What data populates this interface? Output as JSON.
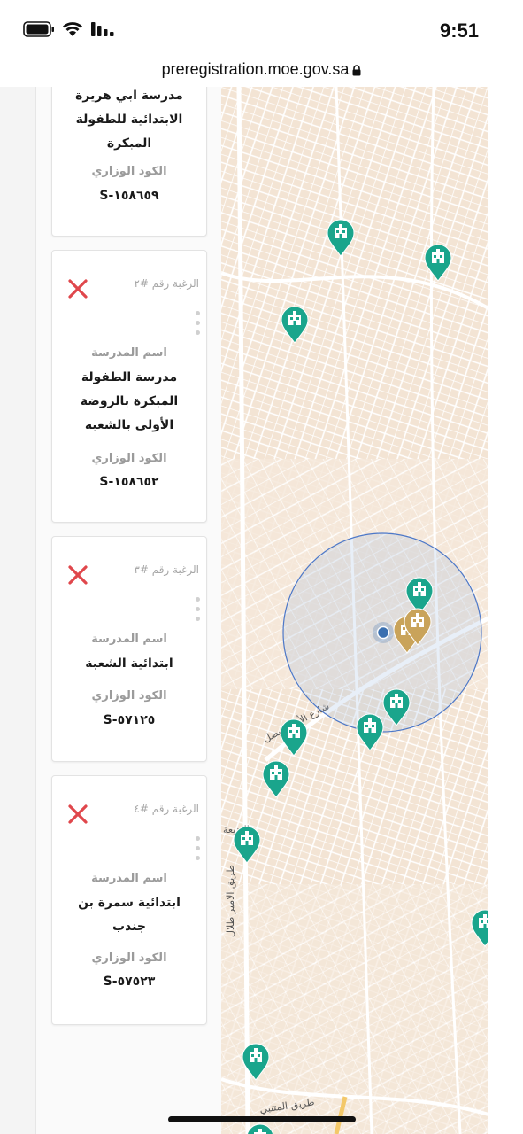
{
  "status_bar": {
    "time": "9:51"
  },
  "browser": {
    "url": "preregistration.moe.gov.sa"
  },
  "cards": [
    {
      "rank": "",
      "school_label": "",
      "school_name_lines": [
        "مدرسة ابي هريرة",
        "الابتدائية للطفولة",
        "المبكرة"
      ],
      "code_label": "الكود الوزاري",
      "code": "S-١٥٨٦٥٩"
    },
    {
      "rank": "الرغبة رقم #٢",
      "school_label": "اسم المدرسة",
      "school_name_lines": [
        "مدرسة الطفولة",
        "المبكرة بالروضة",
        "الأولى بالشعبة"
      ],
      "code_label": "الكود الوزاري",
      "code": "S-١٥٨٦٥٢"
    },
    {
      "rank": "الرغبة رقم #٣",
      "school_label": "اسم المدرسة",
      "school_name_lines": [
        "ابتدائية الشعبة"
      ],
      "code_label": "الكود الوزاري",
      "code": "S-٥٧١٢٥"
    },
    {
      "rank": "الرغبة رقم #٤",
      "school_label": "اسم المدرسة",
      "school_name_lines": [
        "ابتدائية سمرة بن",
        "جندب"
      ],
      "code_label": "الكود الوزاري",
      "code": "S-٥٧٥٢٣"
    }
  ],
  "map": {
    "street_labels": [
      "شارع الأمير فيصل",
      "طريق الامير طلال",
      "طريق المتنبي",
      "البديعة"
    ],
    "pin_colors": {
      "school": "#1aa58c",
      "selected": "#c9a35a",
      "location": "#3a6fb0"
    },
    "school_pin_count": 12,
    "selected_pin_count": 2
  }
}
